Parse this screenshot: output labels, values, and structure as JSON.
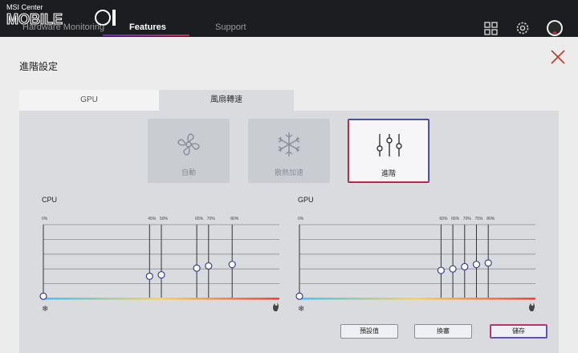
{
  "app": {
    "title": "MSI Center",
    "nav": [
      {
        "label": "Hardware Monitoring"
      },
      {
        "label": "Features"
      },
      {
        "label": "Support"
      }
    ]
  },
  "panel": {
    "title": "進階設定",
    "subtabs": [
      {
        "label": "GPU"
      },
      {
        "label": "風扇轉速"
      }
    ],
    "modes": [
      {
        "label": "自動",
        "icon": "fan-icon"
      },
      {
        "label": "散熱加速",
        "icon": "snowflake-icon"
      },
      {
        "label": "進階",
        "icon": "sliders-icon"
      }
    ],
    "buttons": {
      "defaults": "預設值",
      "apply": "換審",
      "save": "儲存"
    }
  },
  "charts": [
    {
      "title": "CPU",
      "ticks": [
        "0%",
        "45%",
        "50%",
        "65%",
        "70%",
        "80%"
      ],
      "tick_values": [
        0,
        45,
        50,
        65,
        70,
        80
      ],
      "points": [
        [
          0,
          3
        ],
        [
          45,
          30
        ],
        [
          50,
          32
        ],
        [
          65,
          41
        ],
        [
          70,
          44
        ],
        [
          80,
          46
        ]
      ]
    },
    {
      "title": "GPU",
      "ticks": [
        "0%",
        "60%",
        "65%",
        "70%",
        "75%",
        "80%"
      ],
      "tick_values": [
        0,
        60,
        65,
        70,
        75,
        80
      ],
      "points": [
        [
          0,
          3
        ],
        [
          60,
          38
        ],
        [
          65,
          40
        ],
        [
          70,
          43
        ],
        [
          75,
          46
        ],
        [
          80,
          48
        ]
      ]
    }
  ],
  "colors": {
    "accent": "#d0284b",
    "accent2": "#3b3f8f",
    "appbar": "#1c1d20"
  }
}
